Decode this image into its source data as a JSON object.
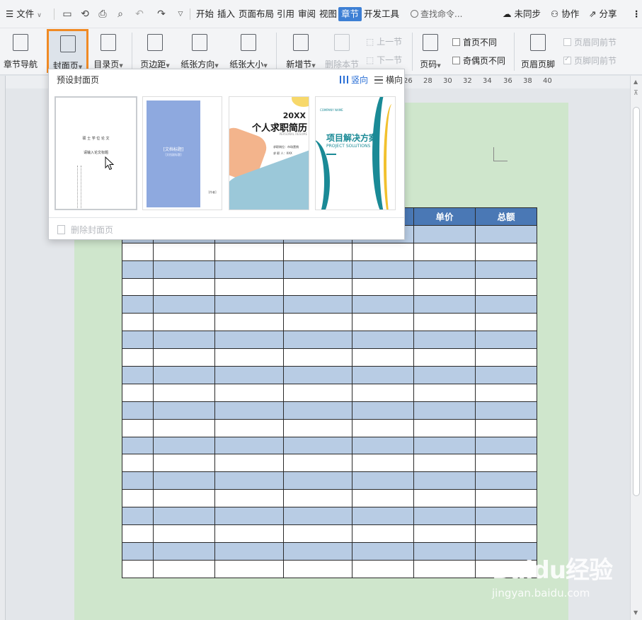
{
  "menubar": {
    "file": "文件",
    "tabs": [
      "开始",
      "插入",
      "页面布局",
      "引用",
      "审阅",
      "视图",
      "章节",
      "开发工具"
    ],
    "active_tab": "章节",
    "search_placeholder": "查找命令...",
    "sync": "未同步",
    "collab": "协作",
    "share": "分享",
    "accent_color": "#3d7fd4"
  },
  "ribbon": {
    "nav": "章节导航",
    "cover": "封面页",
    "toc": "目录页",
    "margins": "页边距",
    "orientation": "纸张方向",
    "size": "纸张大小",
    "new_section": "新增节",
    "delete_section": "删除本节",
    "prev_section": "上一节",
    "next_section": "下一节",
    "page_number": "页码",
    "first_page_diff": "首页不同",
    "odd_even_diff": "奇偶页不同",
    "header_footer": "页眉页脚",
    "same_header": "页眉同前节",
    "same_footer": "页脚同前节",
    "highlight_color": "#f08a24"
  },
  "ruler": {
    "ticks": [
      "26",
      "28",
      "30",
      "32",
      "34",
      "36",
      "38",
      "40"
    ]
  },
  "dropdown": {
    "title": "预设封面页",
    "portrait": "竖向",
    "landscape": "横向",
    "delete": "删除封面页",
    "templates": {
      "t1": {
        "lines": [
          "硕 士 学 位 论 文",
          "请输入论文标题"
        ]
      },
      "t2": {
        "title": "[文档标题]",
        "subtitle": "[文档副标题]",
        "author": "[作者]"
      },
      "t3": {
        "year": "20XX",
        "title": "个人求职简历",
        "sub": "PERSONAL RESUME",
        "job": "求职岗位：市场营销",
        "name": "求 职 人：XXX"
      },
      "t4": {
        "company": "COMPANY NAME",
        "title": "项目解决方案",
        "sub": "PROJECT SOLUTIONS"
      }
    }
  },
  "table": {
    "headers": [
      "单价",
      "总额"
    ],
    "header_color": "#4a78b5",
    "band_color": "#b8cce4"
  },
  "watermark": {
    "brand": "Baidu经验",
    "url": "jingyan.baidu.com"
  }
}
